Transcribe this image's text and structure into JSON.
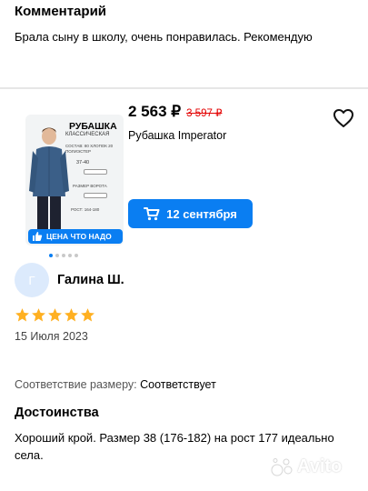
{
  "comment": {
    "heading": "Комментарий",
    "text": "Брала сыну в школу, очень понравилась. Рекомендую"
  },
  "product": {
    "price_current": "2 563 ₽",
    "price_old": "3 597 ₽",
    "name": "Рубашка Imperator",
    "image": {
      "title": "РУБАШКА",
      "subtitle": "КЛАССИЧЕСКАЯ",
      "composition": "СОСТАВ: 80 ХЛОПОК 20 ПОЛИЭСТЕР",
      "size_range": "37-40",
      "collar_label": "РАЗМЕР ВОРОТА",
      "height_label": "РОСТ: 164-180"
    },
    "badge": "ЦЕНА ЧТО НАДО",
    "delivery_label": "12 сентября",
    "carousel_dots": 5,
    "active_dot": 0
  },
  "reviewer": {
    "avatar_letter": "Г",
    "name": "Галина Ш.",
    "rating": 5,
    "date": "15 Июля 2023"
  },
  "size_fit": {
    "label": "Соответствие размеру:",
    "value": "Соответствует"
  },
  "pros": {
    "heading": "Достоинства",
    "text": "Хороший крой. Размер 38 (176-182) на рост 177 идеально села."
  },
  "watermark": "Avito",
  "colors": {
    "accent": "#0a7ef2",
    "star": "#ffb021",
    "old_price": "#e30000"
  }
}
